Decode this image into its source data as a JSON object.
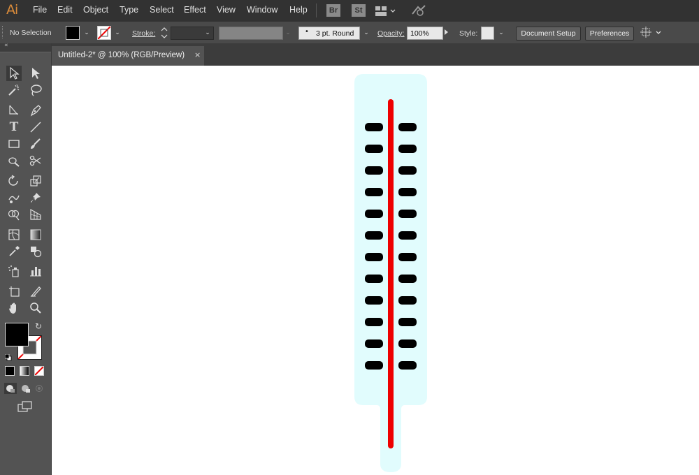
{
  "app": {
    "logo": "Ai"
  },
  "menu": {
    "items": [
      "File",
      "Edit",
      "Object",
      "Type",
      "Select",
      "Effect",
      "View",
      "Window",
      "Help"
    ]
  },
  "menubar_icons": {
    "bridge": "Br",
    "stock": "St"
  },
  "control": {
    "selection_label": "No Selection",
    "stroke_label": "Stroke:",
    "brush_label": "3 pt. Round",
    "opacity_label": "Opacity:",
    "opacity_value": "100%",
    "style_label": "Style:",
    "document_setup": "Document Setup",
    "preferences": "Preferences"
  },
  "document": {
    "tab_title": "Untitled-2* @ 100% (RGB/Preview)",
    "close_glyph": "×"
  },
  "colors": {
    "fill": "#000000",
    "stroke": "none",
    "thermometer_body": "#e1fcfd",
    "mercury": "#ee0000",
    "ticks": "#000000"
  },
  "tools": [
    "selection-tool",
    "direct-selection-tool",
    "magic-wand-tool",
    "lasso-tool",
    "anchor-tool",
    "pen-tool",
    "type-tool",
    "line-tool",
    "rectangle-tool",
    "paintbrush-tool",
    "blob-brush-tool",
    "scissors-tool",
    "rotate-tool",
    "scale-tool",
    "warp-tool",
    "pin-tool",
    "shape-builder-tool",
    "perspective-tool",
    "mesh-tool",
    "gradient-tool",
    "eyedropper-tool",
    "blend-tool",
    "symbol-sprayer-tool",
    "column-graph-tool",
    "artboard-tool",
    "slice-tool",
    "hand-tool",
    "zoom-tool"
  ]
}
